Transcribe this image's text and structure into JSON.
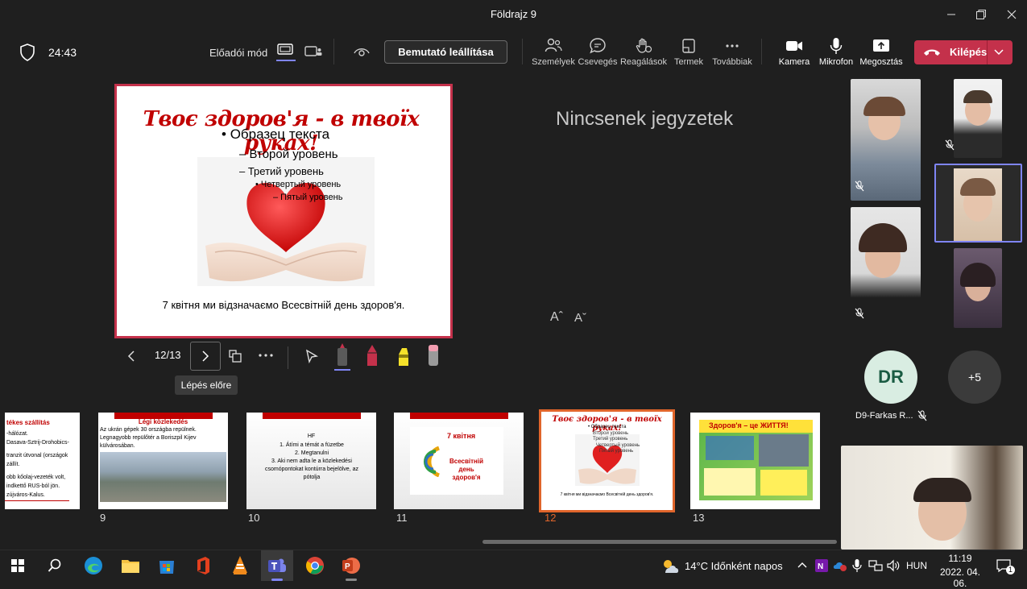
{
  "window": {
    "title": "Földrajz 9"
  },
  "toolbar": {
    "timer": "24:43",
    "presenter_mode_label": "Előadói mód",
    "stop_presenting_label": "Bemutató leállítása",
    "items": [
      {
        "label": "Személyek",
        "icon": "people-icon"
      },
      {
        "label": "Csevegés",
        "icon": "chat-icon"
      },
      {
        "label": "Reagálások",
        "icon": "reaction-icon"
      },
      {
        "label": "Termek",
        "icon": "rooms-icon"
      },
      {
        "label": "Továbbiak",
        "icon": "more-icon"
      },
      {
        "label": "Kamera",
        "icon": "camera-icon"
      },
      {
        "label": "Mikrofon",
        "icon": "microphone-icon"
      },
      {
        "label": "Megosztás",
        "icon": "share-icon"
      }
    ],
    "leave_label": "Kilépés",
    "leave_color": "#c4314b"
  },
  "slide": {
    "title": "Твоє здоров'я - в твоїх руках!",
    "levels": [
      "Образец текста",
      "– Второй уровень",
      "– Третий уровень",
      "• Четвертый уровень",
      "– Пятый уровень"
    ],
    "caption": "7 квітня ми відзначаємо Всесвітній день здоров'я."
  },
  "notes": {
    "empty_text": "Nincsenek jegyzetek",
    "font_grow": "Aˆ",
    "font_shrink": "Aˇ"
  },
  "navigator": {
    "counter": "12/13",
    "next_tooltip": "Lépés előre"
  },
  "thumbnails": [
    {
      "number": "",
      "title": "tékes szállítás",
      "lines": [
        "-hálózat.",
        "Dasava-Sztrij-Drohobics-",
        "tranzit útvonal (országok",
        "zállít.",
        "obb kőolaj-vezeték volt,",
        "indkettő RUS-ból jön.",
        "zújváros-Kalus."
      ]
    },
    {
      "number": "9",
      "title": "Légi közlekedés",
      "lines": [
        "Az ukrán gépek 30 országba repülnek.",
        "Legnagyobb repülőtér a Boriszpil Kijev",
        "külvárosában."
      ]
    },
    {
      "number": "10",
      "title": "HF",
      "lines": [
        "1.   Átími a témát a füzetbe",
        "2.   Megtanulni",
        "3.   Aki nem adta le a közlekedési",
        "csomópontokat kontúrra bejelölve, az",
        "pótolja"
      ]
    },
    {
      "number": "11",
      "title": "7 квітня",
      "lines": [
        "Всесвітній",
        "день",
        "здоров'я"
      ]
    },
    {
      "number": "12",
      "title": "Твоє здоров'я - в твоїх руках!",
      "lines": [
        "• Образец текста",
        "Второй уровень",
        "Третий уровень",
        "Четвертый уровень",
        "Пятый уровень",
        "7 квітня ми відзначаємо Всесвітній день здоров'я."
      ]
    },
    {
      "number": "13",
      "title": "Здоров'я – це ЖИТТЯ!",
      "lines": []
    }
  ],
  "participants": {
    "avatar_initials": "DR",
    "avatar_name": "D9-Farkas R...",
    "overflow": "+5"
  },
  "taskbar": {
    "weather": "14°C  Időnként napos",
    "language": "HUN",
    "time": "11:19",
    "date": "2022. 04. 06.",
    "notifications": "1"
  }
}
